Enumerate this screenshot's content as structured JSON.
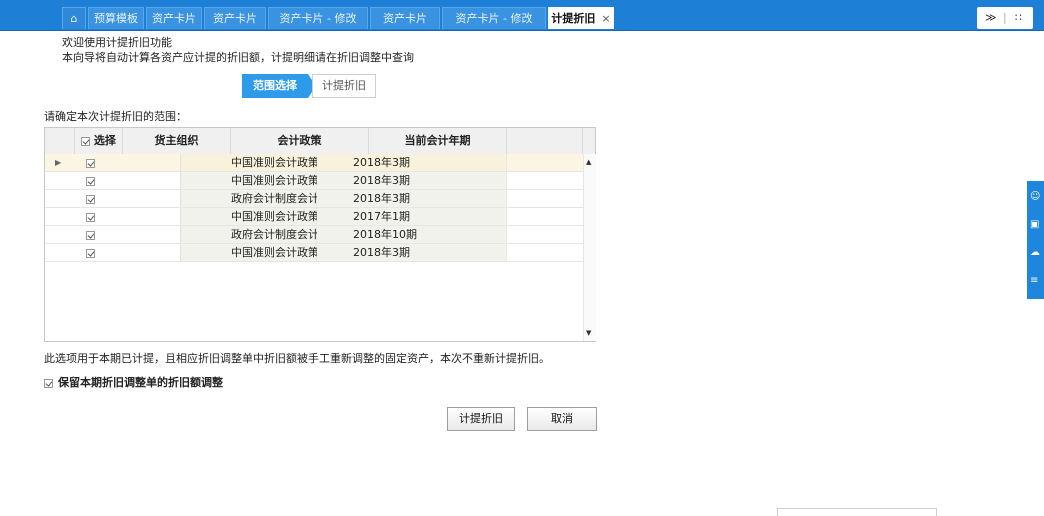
{
  "tabs": [
    {
      "label": "预算模板"
    },
    {
      "label": "资产卡片"
    },
    {
      "label": "资产卡片"
    },
    {
      "label": "资产卡片 - 修改"
    },
    {
      "label": "资产卡片"
    },
    {
      "label": "资产卡片 - 修改"
    },
    {
      "label": "计提折旧",
      "close": "×"
    }
  ],
  "tab_tools": {
    "collapse": "≫",
    "grid": "∷"
  },
  "intro": {
    "line1": "欢迎使用计提折旧功能",
    "line2": "本向导将自动计算各资产应计提的折旧额，计提明细请在折旧调整中查询"
  },
  "steps": {
    "active": "范围选择",
    "next": "计提折旧"
  },
  "range_label": "请确定本次计提折旧的范围：",
  "grid": {
    "headers": {
      "select": "选择",
      "org": "货主组织",
      "policy": "会计政策",
      "period": "当前会计年期"
    },
    "rows": [
      {
        "policy": "中国准则会计政策",
        "period": "2018年3期"
      },
      {
        "policy": "中国准则会计政策",
        "period": "2018年3期"
      },
      {
        "policy": "政府会计制度会计政策",
        "period": "2018年3期"
      },
      {
        "policy": "中国准则会计政策",
        "period": "2017年1期"
      },
      {
        "policy": "政府会计制度会计政策",
        "period": "2018年10期"
      },
      {
        "policy": "中国准则会计政策",
        "period": "2018年3期"
      }
    ]
  },
  "note": "此选项用于本期已计提，且相应折旧调整单中折旧额被手工重新调整的固定资产，本次不重新计提折旧。",
  "keep_adjust": {
    "label": "保留本期折旧调整单的折旧额调整",
    "checked": true
  },
  "buttons": {
    "confirm": "计提折旧",
    "cancel": "取消"
  },
  "colors": {
    "tab_bar": "#1e7fd6",
    "step_active": "#2e9bea",
    "side_toolbar": "#1e86dd"
  }
}
